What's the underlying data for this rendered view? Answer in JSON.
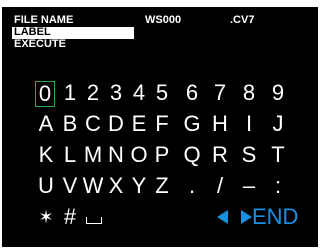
{
  "menu": [
    "FILE NAME",
    "LABEL",
    "EXECUTE"
  ],
  "file": {
    "name": "WS000",
    "extension": ".CV7"
  },
  "keyboard": {
    "rows": [
      [
        "0",
        "1",
        "2",
        "3",
        "4",
        "5",
        "6",
        "7",
        "8",
        "9"
      ],
      [
        "A",
        "B",
        "C",
        "D",
        "E",
        "F",
        "G",
        "H",
        "I",
        "J"
      ],
      [
        "K",
        "L",
        "M",
        "N",
        "O",
        "P",
        "Q",
        "R",
        "S",
        "T"
      ],
      [
        "U",
        "V",
        "W",
        "X",
        "Y",
        "Z",
        ".",
        "/",
        "–",
        ":"
      ],
      [
        "✶",
        "#",
        "space",
        "",
        "",
        "",
        "◀",
        "▶",
        "END",
        ""
      ]
    ],
    "selected": "0",
    "end_label": "END",
    "accent_color": "#1a8fe0",
    "selection_color": "#2ea84a"
  }
}
